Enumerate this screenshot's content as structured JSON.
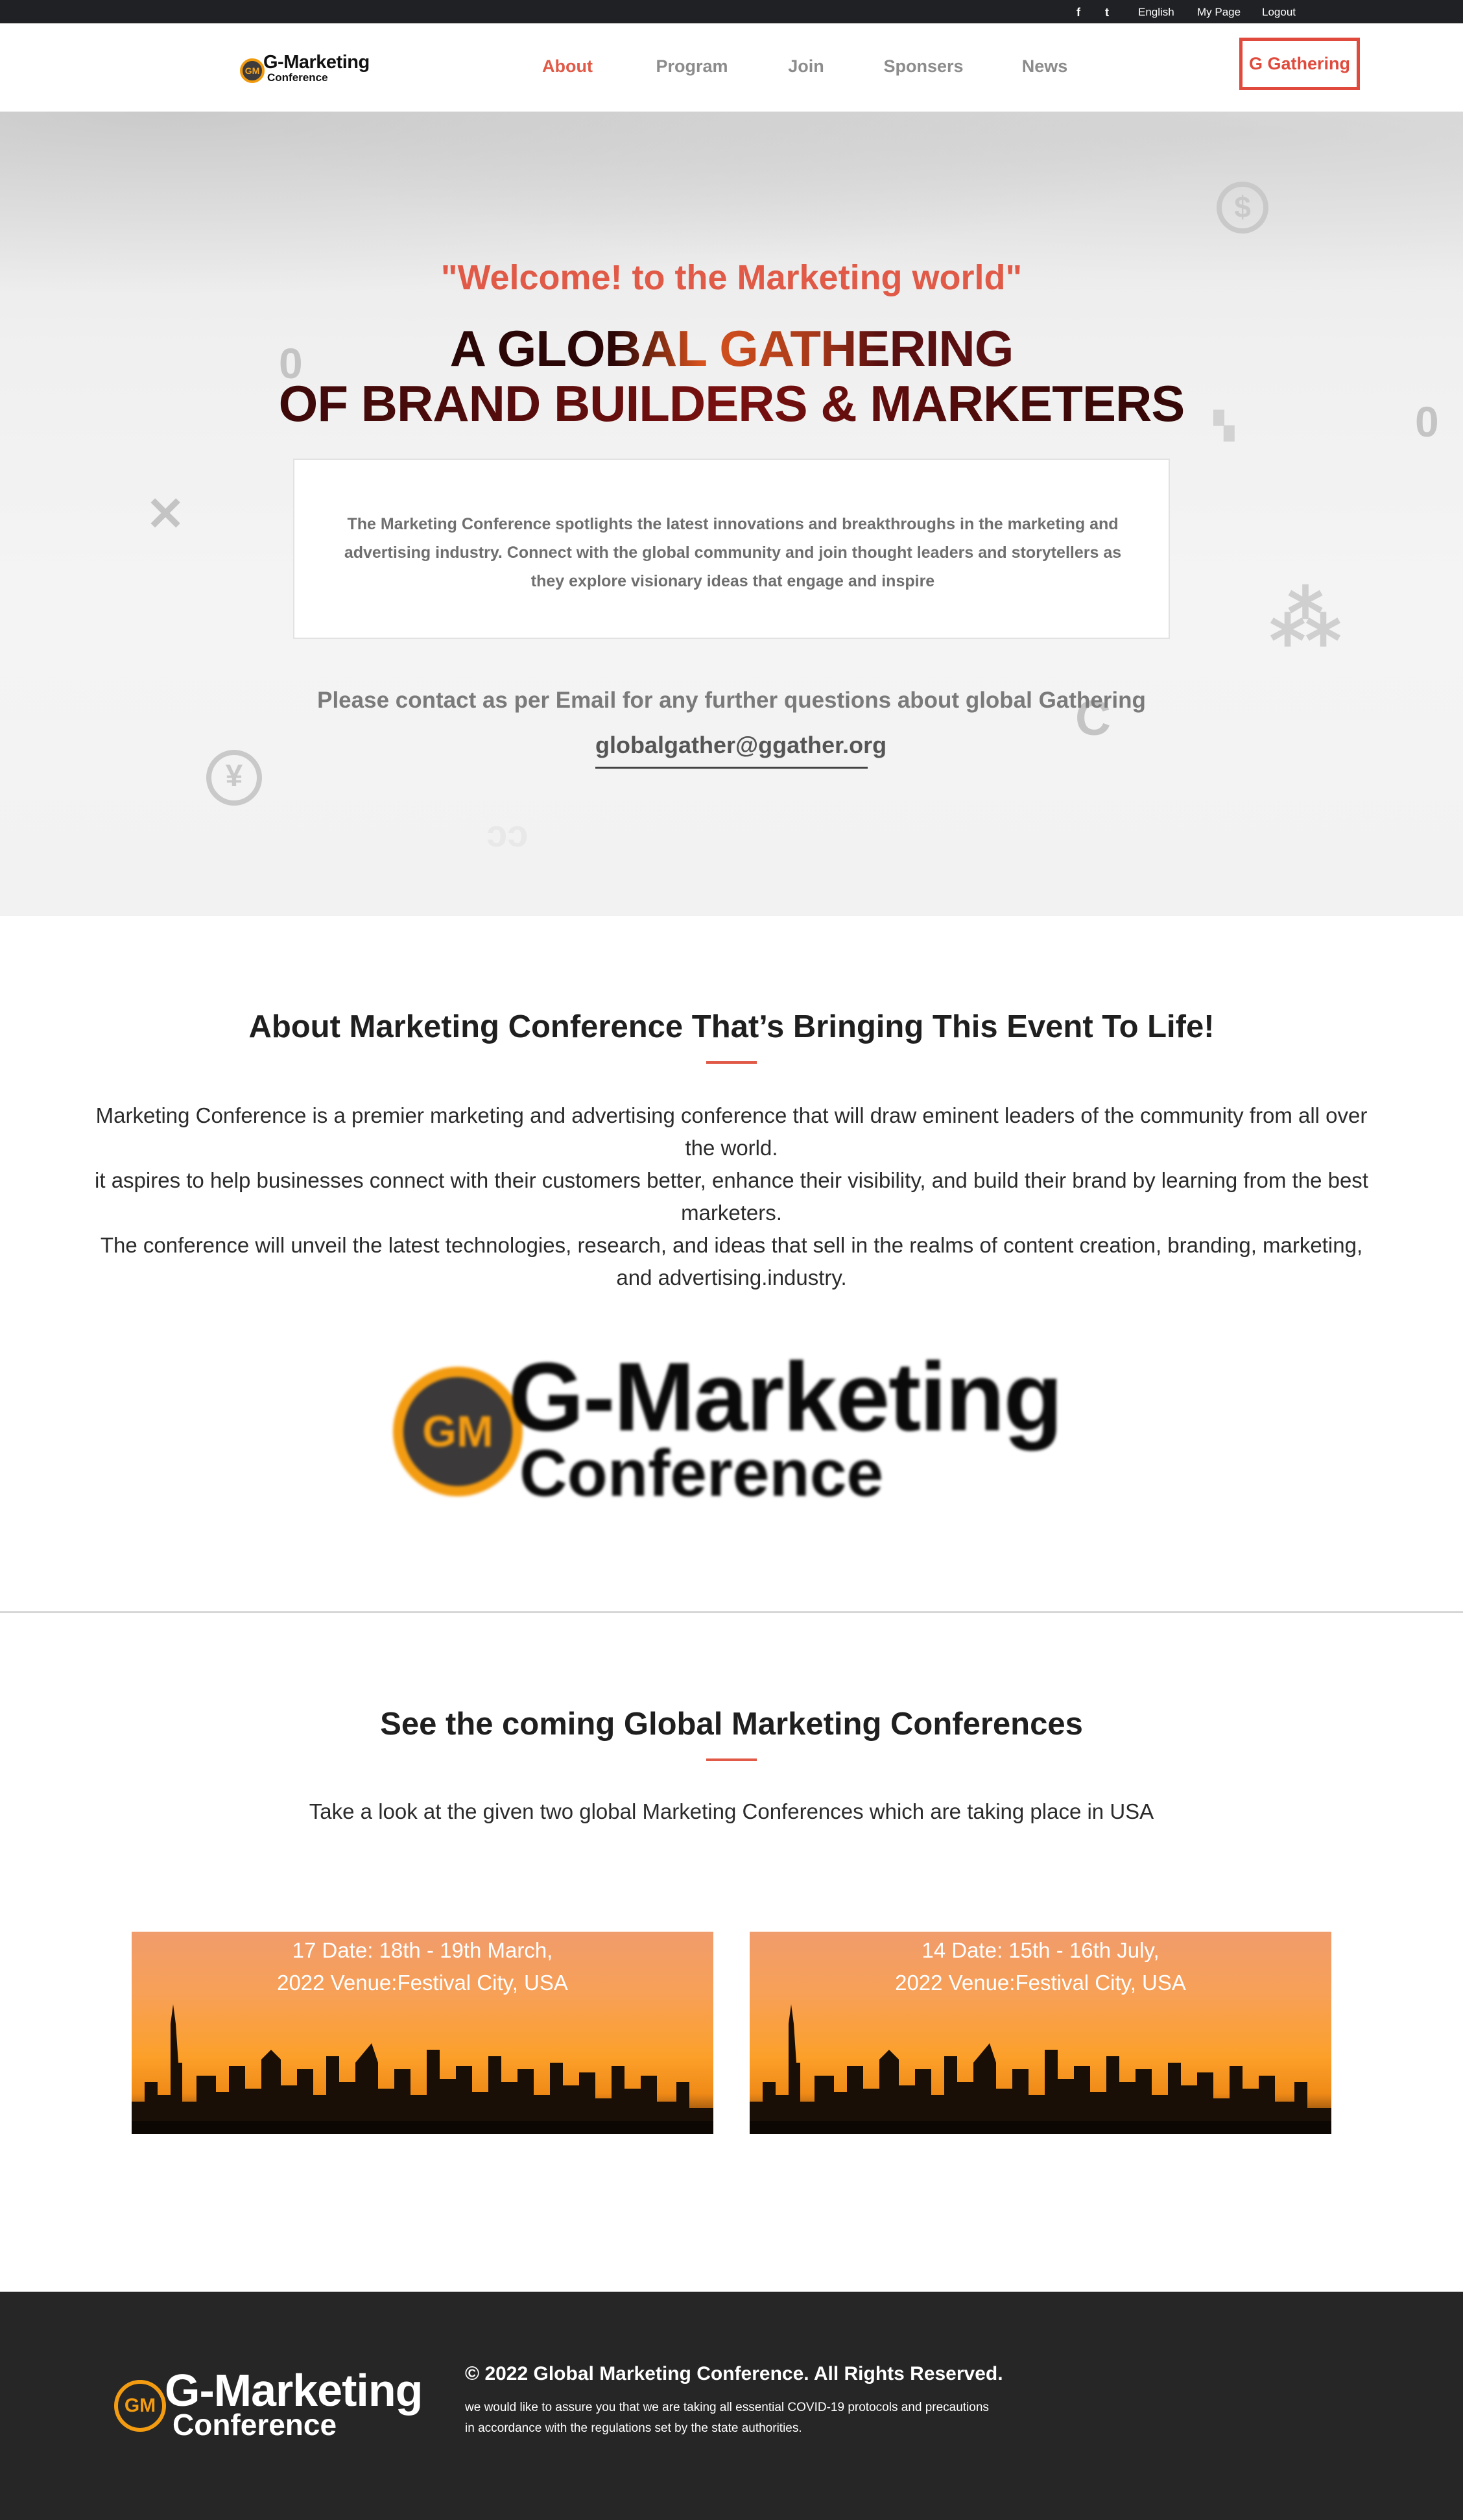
{
  "topbar": {
    "facebook_icon": "f",
    "twitter_icon": "t",
    "language": "English",
    "my_page": "My Page",
    "logout": "Logout"
  },
  "header": {
    "logo": {
      "mark": "GM",
      "line1": "G-Marketing",
      "line2": "Conference"
    },
    "nav": [
      "About",
      "Program",
      "Join",
      "Sponsers",
      "News"
    ],
    "active_nav": "About",
    "cta_label": "G Gathering"
  },
  "hero": {
    "welcome": "\"Welcome! to the Marketing world\"",
    "headline_1": "A GLOBAL GATHERING",
    "headline_2": "OF BRAND BUILDERS & MARKETERS",
    "description": "The Marketing Conference spotlights the latest innovations and breakthroughs in the marketing and advertising industry. Connect with the global community and join thought leaders and storytellers as they explore visionary ideas that engage and inspire",
    "contact_text": "Please contact as per Email for any further questions about global Gathering",
    "email": "globalgather@ggather.org"
  },
  "about": {
    "title": "About Marketing Conference That’s Bringing This Event To Life!",
    "paragraphs": [
      "Marketing Conference is a premier marketing and advertising conference that will draw eminent leaders of the community from all over the world.",
      "it aspires to help businesses connect with their customers better, enhance their visibility, and build their brand by learning from the best marketers.",
      "The conference will unveil the latest technologies, research, and ideas that sell in the realms of content creation, branding, marketing, and advertising.industry."
    ],
    "logo": {
      "mark": "GM",
      "line1": "G-Marketing",
      "line2": "Conference"
    }
  },
  "events": {
    "title": "See the coming Global Marketing Conferences",
    "subtitle": "Take a look at the given two global Marketing Conferences which are taking place in USA",
    "cards": [
      {
        "line1": "17 Date: 18th - 19th March,",
        "line2": "2022 Venue:Festival City, USA"
      },
      {
        "line1": "14 Date: 15th - 16th July,",
        "line2": "2022 Venue:Festival City, USA"
      }
    ]
  },
  "footer": {
    "logo": {
      "mark": "GM",
      "line1": "G-Marketing",
      "line2": "Conference"
    },
    "copyright": "© 2022 Global Marketing Conference. All Rights Reserved.",
    "note_1": "we would like to assure you that we are taking all essential COVID-19 protocols and precautions",
    "note_2": "in accordance with the regulations set by the state authorities."
  },
  "colors": {
    "accent": "#e05a47",
    "top_bar": "#202124",
    "footer": "#262626",
    "logo_orange": "#f39c12"
  }
}
